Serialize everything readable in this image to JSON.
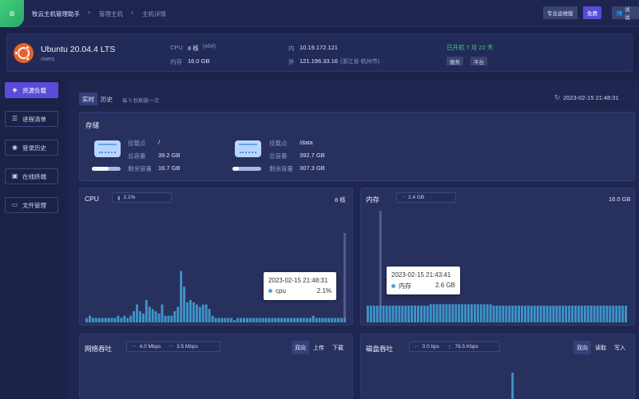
{
  "breadcrumb": {
    "app": "牧云主机管理助手",
    "manage": "管理主机",
    "detail": "主机详情"
  },
  "topbar": {
    "pro_label": "专业运维版",
    "free_badge": "免费",
    "user_label": "试试"
  },
  "host": {
    "os": "Ubuntu 20.04.4 LTS",
    "user": "rivers",
    "cpu_label": "CPU",
    "cpu_value": "8 核",
    "cpu_arch": "(x64)",
    "mem_label": "内存",
    "mem_value": "16.0 GB",
    "ip_in_label": "内",
    "ip_in": "10.19.172.121",
    "ip_out_label": "外",
    "ip_out": "121.196.33.16",
    "ip_out_location": "(浙江省-杭州市)",
    "uptime": "已开机 7 月 22 天",
    "tags": [
      "服务",
      "平台"
    ]
  },
  "sidebar": {
    "items": [
      {
        "label": "资源负载",
        "icon": "layers-icon",
        "active": true
      },
      {
        "label": "进程清单",
        "icon": "list-icon",
        "active": false
      },
      {
        "label": "登录历史",
        "icon": "user-circle-icon",
        "active": false
      },
      {
        "label": "在线终端",
        "icon": "terminal-icon",
        "active": false
      },
      {
        "label": "文件管理",
        "icon": "folder-icon",
        "active": false
      }
    ]
  },
  "tabs": {
    "realtime": "实时",
    "history": "历史",
    "refresh_note": "每 5 秒刷新一次",
    "timestamp": "2023-02-15 21:48:31"
  },
  "storage": {
    "title": "存储",
    "mount_label": "挂载点",
    "total_label": "总容量",
    "free_label": "剩余容量",
    "disks": [
      {
        "mount": "/",
        "total": "39.2 GB",
        "free": "16.7 GB",
        "used_ratio": 0.57
      },
      {
        "mount": "/data",
        "total": "392.7 GB",
        "free": "307.3 GB",
        "used_ratio": 0.22
      }
    ]
  },
  "cpu_panel": {
    "title": "CPU",
    "current": "2.1%",
    "cores": "8 核",
    "tooltip": {
      "time": "2023-02-15 21:48:31",
      "series": "cpu",
      "value": "2.1%"
    }
  },
  "mem_panel": {
    "title": "内存",
    "current": "2.4 GB",
    "total": "16.0 GB",
    "tooltip": {
      "time": "2023-02-15 21:43:41",
      "series": "内存",
      "value": "2.6 GB"
    }
  },
  "net_panel": {
    "title": "网络吞吐",
    "in": "4.0 Mbps",
    "out": "3.5 Mbps",
    "tabs": [
      "双向",
      "上传",
      "下载"
    ]
  },
  "disk_panel": {
    "title": "磁盘吞吐",
    "read": "0.0 bps",
    "write": "78.5 Kbps",
    "tabs": [
      "双向",
      "读取",
      "写入"
    ]
  },
  "colors": {
    "accent": "#5b4bd9",
    "bar": "#3f93c8",
    "green": "#3fd07b"
  },
  "chart_data": [
    {
      "type": "bar",
      "title": "CPU",
      "unit": "%",
      "values": [
        2,
        3,
        2,
        2,
        2,
        2,
        2,
        2,
        2,
        2,
        3,
        2,
        3,
        2,
        3,
        5,
        8,
        5,
        4,
        10,
        7,
        6,
        5,
        4,
        8,
        3,
        3,
        3,
        5,
        7,
        23,
        16,
        9,
        10,
        9,
        8,
        7,
        8,
        8,
        6,
        3,
        2,
        2,
        2,
        2,
        2,
        2,
        1,
        2,
        2,
        2,
        2,
        2,
        2,
        2,
        2,
        2,
        2,
        2,
        2,
        2,
        2,
        2,
        2,
        2,
        2,
        2,
        2,
        2,
        2,
        2,
        2,
        3,
        2,
        2,
        2,
        2,
        2,
        2,
        2,
        2,
        2,
        2
      ],
      "highlight_index": 82,
      "ylim": [
        0,
        40
      ]
    },
    {
      "type": "bar",
      "title": "内存",
      "unit": "GB",
      "values": [
        2.4,
        2.4,
        2.4,
        2.4,
        2.4,
        2.4,
        2.4,
        2.4,
        2.4,
        2.4,
        2.4,
        2.4,
        2.4,
        2.4,
        2.4,
        2.4,
        2.4,
        2.4,
        2.4,
        2.4,
        2.6,
        2.6,
        2.6,
        2.6,
        2.6,
        2.6,
        2.6,
        2.6,
        2.6,
        2.6,
        2.6,
        2.6,
        2.6,
        2.6,
        2.6,
        2.6,
        2.6,
        2.6,
        2.6,
        2.6,
        2.4,
        2.4,
        2.4,
        2.4,
        2.4,
        2.4,
        2.4,
        2.4,
        2.4,
        2.4,
        2.4,
        2.4,
        2.4,
        2.4,
        2.4,
        2.4,
        2.4,
        2.4,
        2.4,
        2.4,
        2.4,
        2.4,
        2.4,
        2.4,
        2.4,
        2.4,
        2.4,
        2.4,
        2.4,
        2.4,
        2.4,
        2.4,
        2.4,
        2.4,
        2.4,
        2.4,
        2.4,
        2.4,
        2.4,
        2.4,
        2.4,
        2.4,
        2.4
      ],
      "highlight_index": 4,
      "ylim": [
        0,
        16
      ]
    },
    {
      "type": "bar",
      "title": "磁盘吞吐",
      "unit": "Kbps",
      "values": [
        0,
        0,
        0,
        0,
        0,
        0,
        0,
        0,
        0,
        0,
        0,
        0,
        0,
        0,
        0,
        0,
        0,
        0,
        0,
        0,
        0,
        0,
        0,
        0,
        0,
        0,
        0,
        0,
        0,
        0,
        0,
        0,
        0,
        0,
        0,
        0,
        0,
        0,
        0,
        0,
        0,
        0,
        0,
        0,
        0,
        0,
        78.5,
        0,
        0,
        0,
        0,
        0,
        0,
        0,
        0,
        0,
        0,
        0,
        0,
        0,
        0,
        0,
        0,
        0,
        0,
        0,
        0,
        0,
        0,
        0,
        0,
        0,
        0,
        0,
        0,
        0,
        0,
        0,
        0,
        0,
        0,
        0,
        0
      ],
      "ylim": [
        0,
        100
      ]
    }
  ]
}
